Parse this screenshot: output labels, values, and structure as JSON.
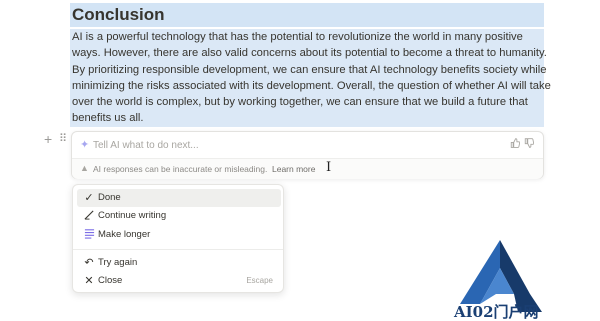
{
  "document": {
    "heading": "Conclusion",
    "paragraph_lines": [
      "AI is a powerful technology that has the potential to revolutionize the world in many positive",
      "ways. However, there are also valid concerns about its potential to become a threat to humanity.",
      "By prioritizing responsible development, we can ensure that AI technology benefits society while",
      "minimizing the risks associated with its development. Overall, the question of whether AI will take",
      "over the world is complex, but by working together, we can ensure that we build a future that",
      "benefits us all."
    ]
  },
  "gutter": {
    "add_icon": "+",
    "drag_icon": "⠿"
  },
  "ai_prompt": {
    "placeholder": "Tell AI what to do next...",
    "sparkle_icon": "✦",
    "thumbs_up_icon": "👍",
    "thumbs_down_icon": "👎",
    "warning_icon": "▲",
    "disclaimer": "AI responses can be inaccurate or misleading.",
    "learn_more": "Learn more"
  },
  "menu": {
    "items": [
      {
        "label": "Done",
        "icon": "✓"
      },
      {
        "label": "Continue writing",
        "icon": "✎"
      },
      {
        "label": "Make longer",
        "icon": "≡"
      },
      {
        "label": "Try again",
        "icon": "↶"
      },
      {
        "label": "Close",
        "icon": "✕",
        "shortcut": "Escape"
      }
    ]
  },
  "watermark": {
    "text": "AI02门户网"
  },
  "colors": {
    "selection": "#dbe8f6",
    "logo_blue": "#2a66b3",
    "logo_dark": "#173a6a",
    "make_longer_icon": "#7c6ee6"
  }
}
